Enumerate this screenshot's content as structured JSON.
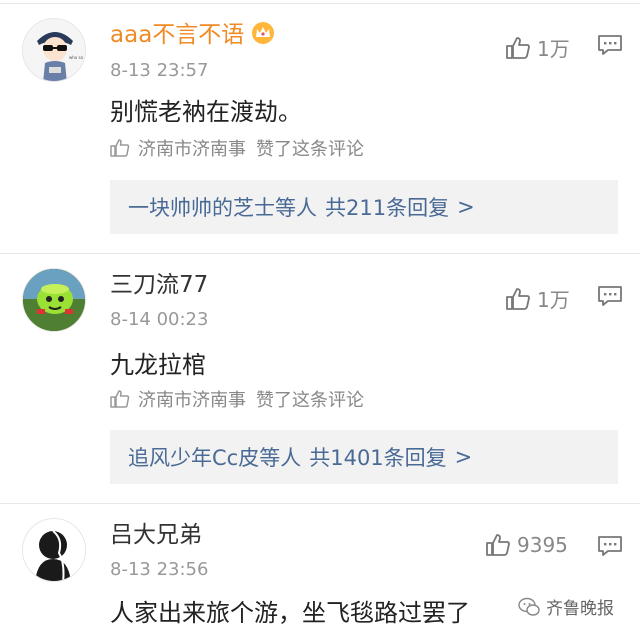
{
  "comments": [
    {
      "username": "aaa不言不语",
      "time": "8-13 23:57",
      "likes": "1万",
      "text": "别慌老衲在渡劫。",
      "liked_by": "济南市济南事",
      "liked_suffix": "赞了这条评论",
      "reply_prefix": "一块帅帅的芝士等人",
      "reply_count": "共211条回复",
      "reply_arrow": ">"
    },
    {
      "username": "三刀流77",
      "time": "8-14 00:23",
      "likes": "1万",
      "text": "九龙拉棺",
      "liked_by": "济南市济南事",
      "liked_suffix": "赞了这条评论",
      "reply_prefix": "追风少年Cc皮等人",
      "reply_count": "共1401条回复",
      "reply_arrow": ">"
    },
    {
      "username": "吕大兄弟",
      "time": "8-13 23:56",
      "likes": "9395",
      "text": "人家出来旅个游，坐飞毯路过罢了"
    }
  ],
  "watermark": "齐鲁晚报",
  "colors": {
    "vip_name": "#f08a24",
    "reply_link": "#4a6a96",
    "reply_bg": "#f2f2f2",
    "meta": "#999999"
  }
}
